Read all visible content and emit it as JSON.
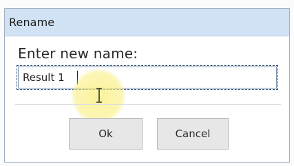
{
  "dialog": {
    "title": "Rename",
    "prompt": "Enter new name:",
    "name_value": "Result 1",
    "ok_label": "Ok",
    "cancel_label": "Cancel"
  },
  "colors": {
    "titlebar": "#d2e2f5",
    "dialog_border": "#9fb0c2",
    "button_bg": "#e7e7e7",
    "cursor_highlight": "#faee78"
  },
  "icons": {
    "cursor": "text-cursor-icon"
  }
}
